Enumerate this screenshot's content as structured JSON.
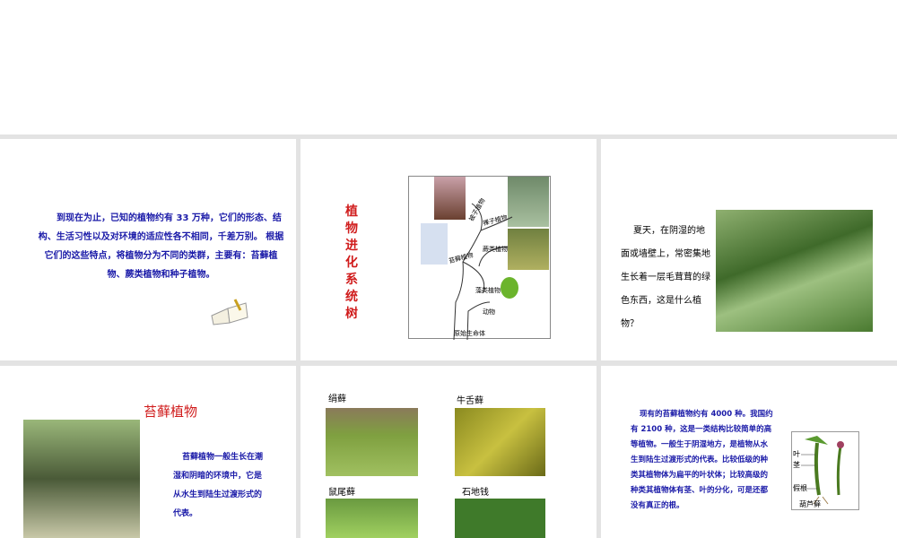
{
  "slides": [
    {
      "text": "到现在为止，已知的植物约有 33 万种，它们的形态、结构、生活习性以及对环境的适应性各不相同，千差万别。 根据它们的这些特点，将植物分为不同的类群，主要有：苔藓植物、蕨类植物和种子植物。"
    },
    {
      "title": "植物进化系统树",
      "labels": [
        "被子植物",
        "裸子植物",
        "蕨类植物",
        "苔藓植物",
        "藻类植物",
        "动物",
        "原始生命体"
      ]
    },
    {
      "text": "夏天，在阴湿的地面或墙壁上，常密集地生长着一层毛茸茸的绿色东西，这是什么植物？"
    },
    {
      "title": "苔藓植物",
      "text": "苔藓植物一般生长在潮湿和阴暗的环境中，它是从水生到陆生过渡形式的代表。"
    },
    {
      "labels": [
        "绢藓",
        "牛舌藓",
        "鼠尾藓",
        "石地钱"
      ]
    },
    {
      "text": "现有的苔藓植物约有 4000 种。我国约有 2100 种，这是一类结构比较简单的高等植物。一般生于阴湿地方，是植物从水生到陆生过渡形式的代表。比较低级的种类其植物体为扁平的叶状体；比较高级的种类其植物体有茎、叶的分化，可是还都没有真正的根。",
      "diagram_labels": [
        "叶",
        "茎",
        "假根",
        "葫芦藓"
      ]
    }
  ]
}
